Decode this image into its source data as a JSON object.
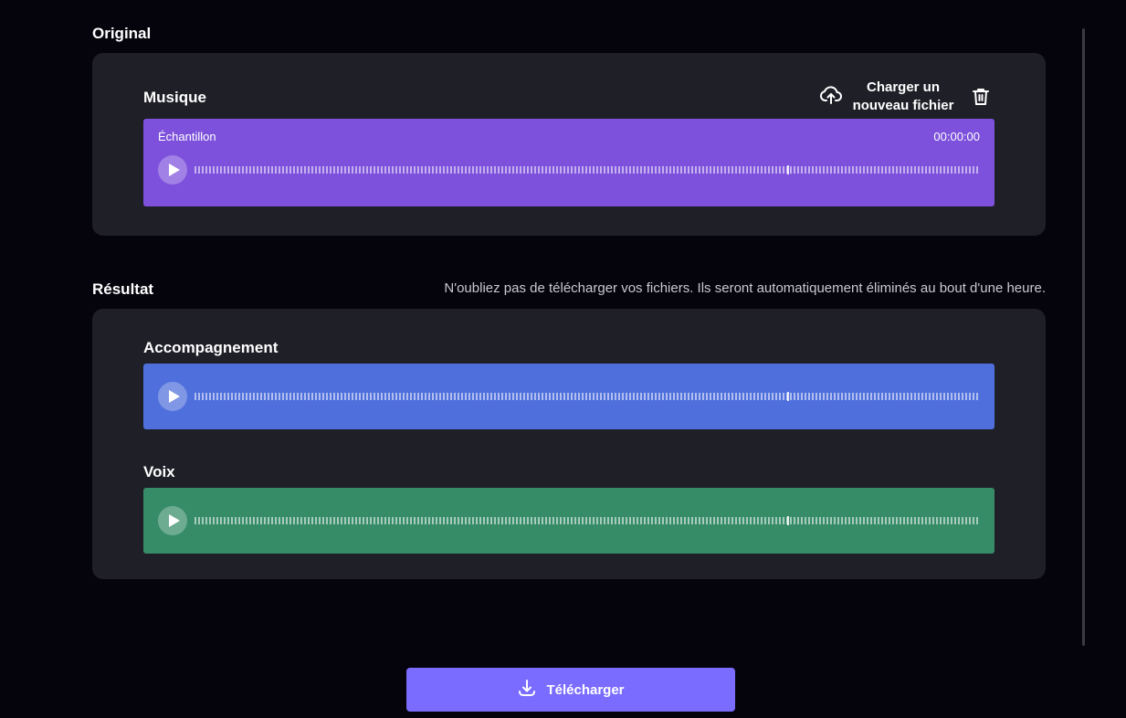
{
  "original": {
    "title": "Original",
    "track": {
      "label": "Musique",
      "player_caption": "Échantillon",
      "time": "00:00:00",
      "color": "#7d51db"
    },
    "upload_label": "Charger un nouveau fichier"
  },
  "result": {
    "title": "Résultat",
    "notice": "N'oubliez pas de télécharger vos fichiers. Ils seront automatiquement éliminés au bout d'une heure.",
    "tracks": [
      {
        "label": "Accompagnement",
        "color": "#4f70dc"
      },
      {
        "label": "Voix",
        "color": "#378c68"
      }
    ]
  },
  "download_label": "Télécharger",
  "icons": [
    "upload-cloud-icon",
    "trash-icon",
    "play-icon",
    "download-icon"
  ]
}
